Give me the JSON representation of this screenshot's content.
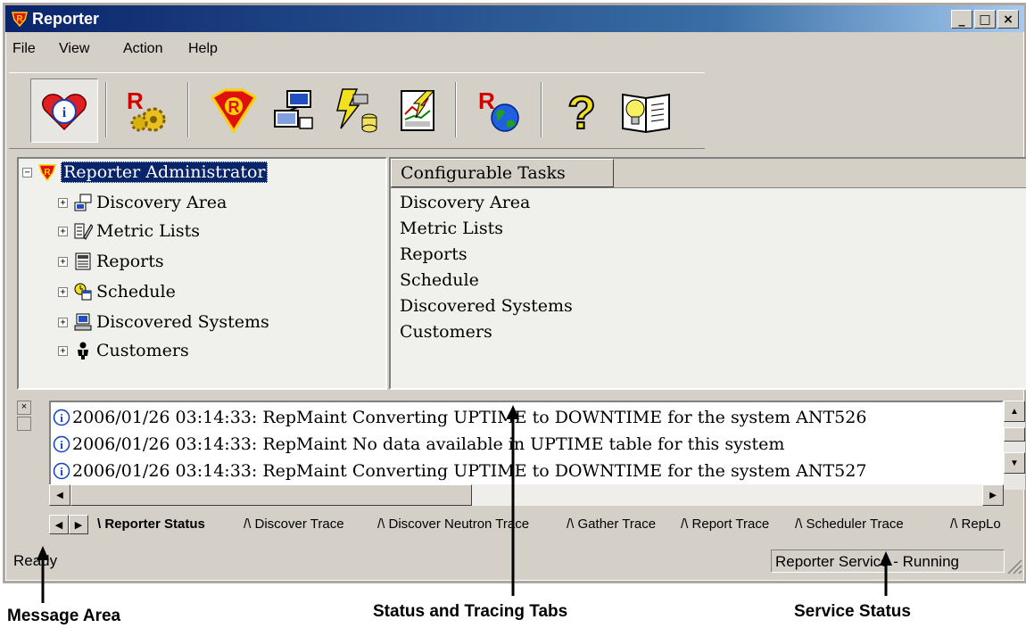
{
  "window": {
    "title": "Reporter"
  },
  "menu": [
    "File",
    "View",
    "Action",
    "Help"
  ],
  "toolbar_icons": [
    "info-heart-icon",
    "reporter-gears-icon",
    "reporter-shield-icon",
    "discovery-icon",
    "gather-icon",
    "chart-icon",
    "reporter-globe-icon",
    "help-question-icon",
    "book-bulb-icon"
  ],
  "tree": {
    "root": "Reporter Administrator",
    "items": [
      "Discovery Area",
      "Metric Lists",
      "Reports",
      "Schedule",
      "Discovered Systems",
      "Customers"
    ]
  },
  "list": {
    "header": "Configurable Tasks",
    "items": [
      "Discovery Area",
      "Metric Lists",
      "Reports",
      "Schedule",
      "Discovered Systems",
      "Customers"
    ]
  },
  "log": {
    "lines": [
      {
        "time": "2006/01/26 03:14:33",
        "msg": ": RepMaint Converting UPTIME to DOWNTIME for the system ANT526"
      },
      {
        "time": "2006/01/26 03:14:33",
        "msg": ": RepMaint No data available in UPTIME table for this system"
      },
      {
        "time": "2006/01/26 03:14:33",
        "msg": ": RepMaint Converting UPTIME to DOWNTIME for the system ANT527"
      }
    ]
  },
  "tabs": [
    "Reporter Status",
    "Discover Trace",
    "Discover Neutron Trace",
    "Gather Trace",
    "Report Trace",
    "Scheduler Trace",
    "RepLo"
  ],
  "status": {
    "message": "Ready",
    "service": "Reporter Service - Running"
  },
  "callouts": {
    "message_area": "Message Area",
    "tabs": "Status and Tracing Tabs",
    "service": "Service Status"
  }
}
